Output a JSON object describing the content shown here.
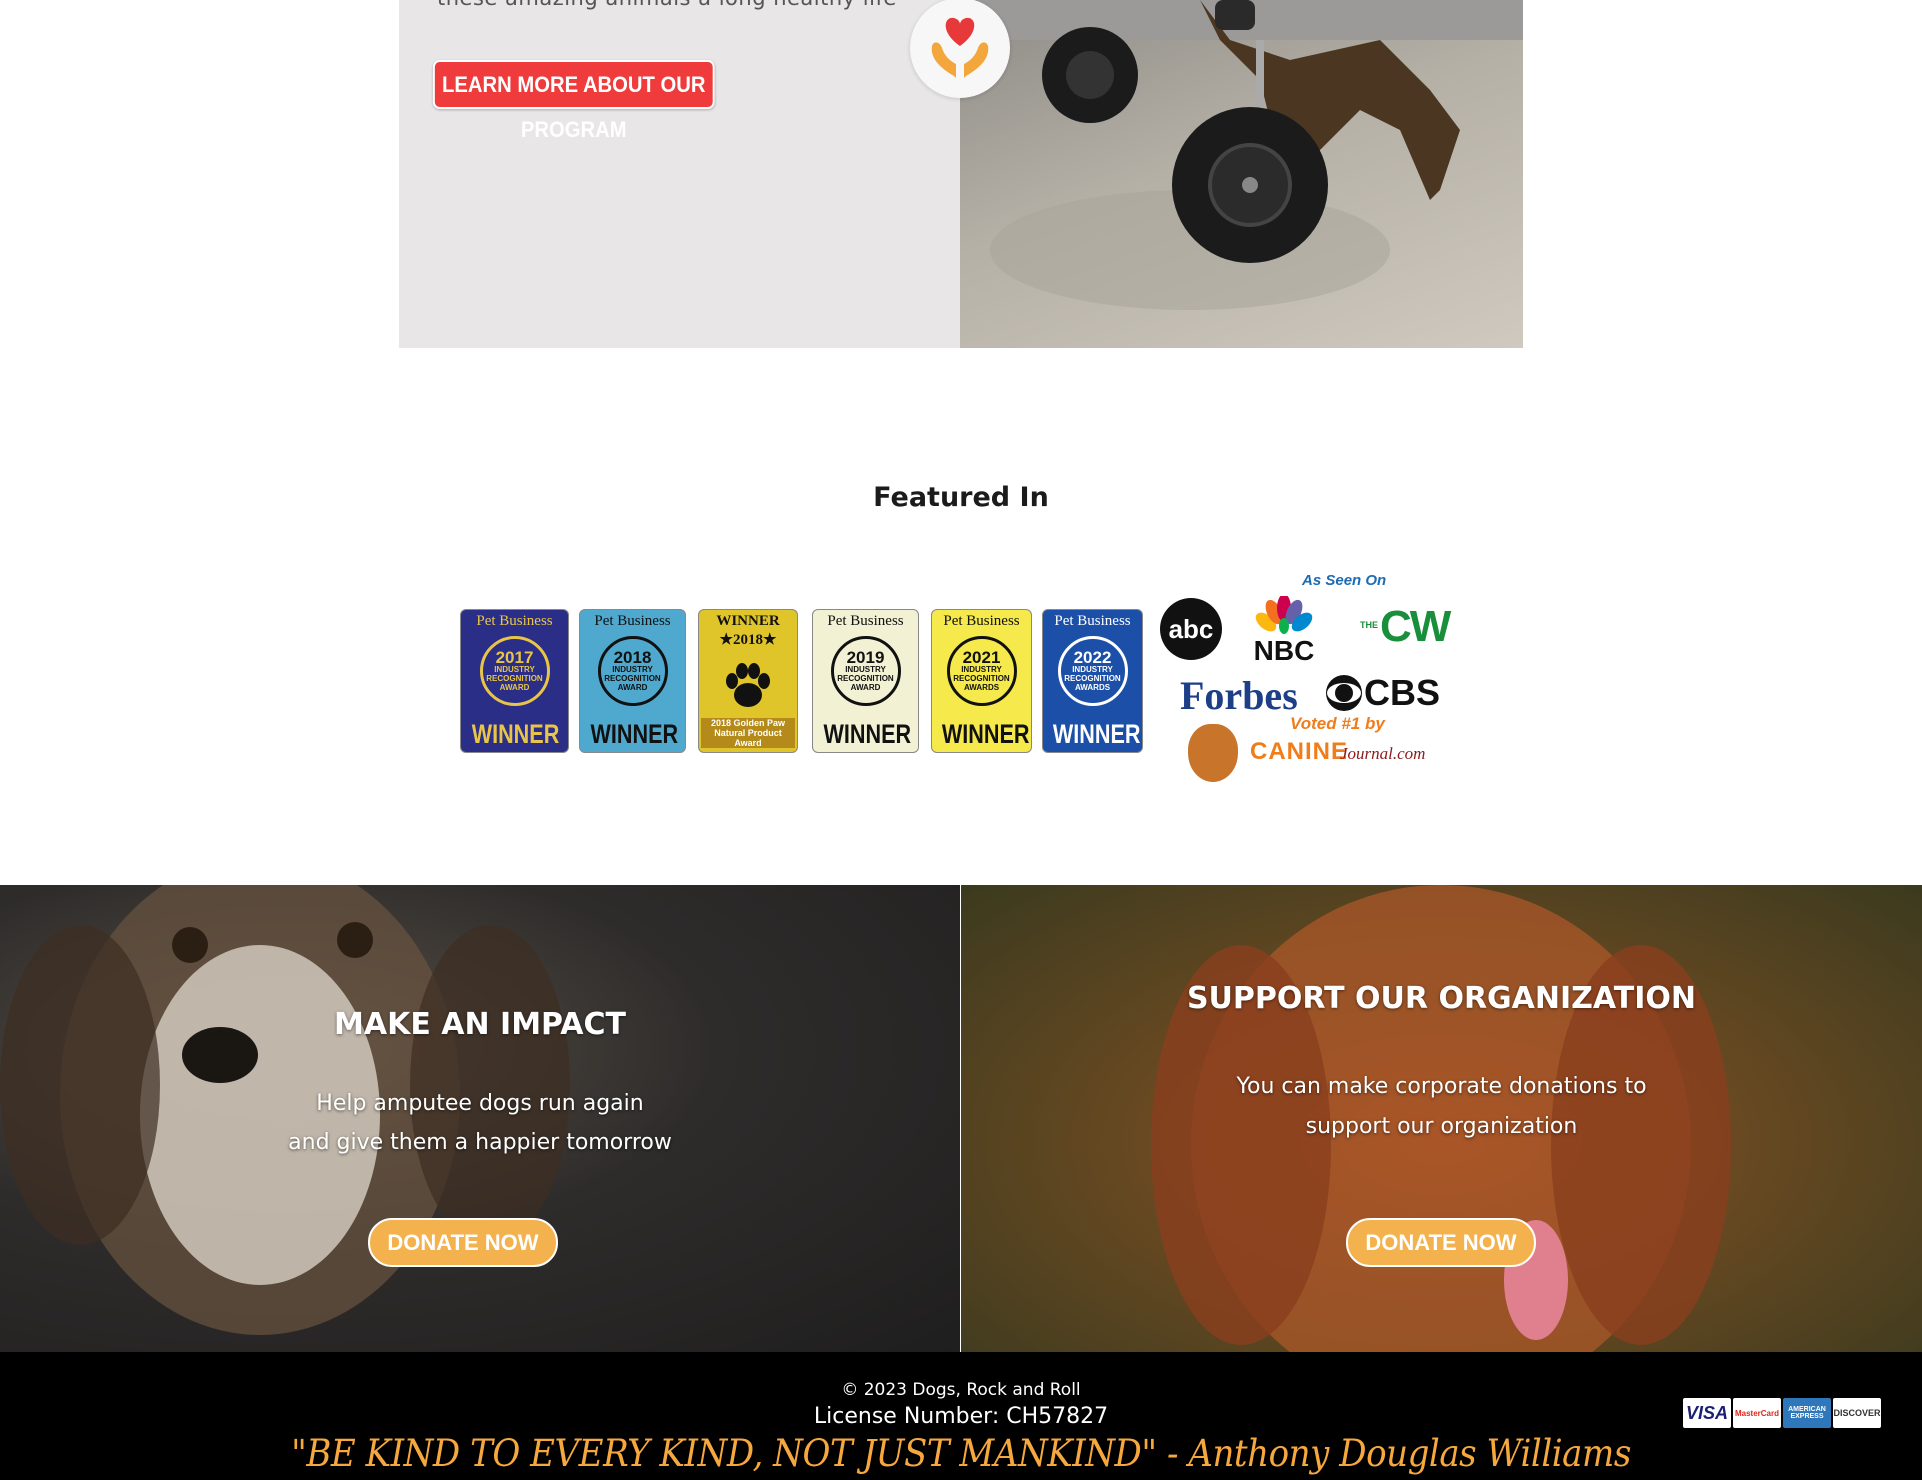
{
  "program": {
    "tagline": "these amazing animals a long healthy life",
    "learn_more_label": "LEARN MORE ABOUT OUR PROGRAM"
  },
  "featured": {
    "title": "Featured In",
    "badges": [
      {
        "brand": "Pet Business",
        "year": "2017",
        "sub": "INDUSTRY RECOGNITION AWARD",
        "win": "WINNER",
        "bg": "#2a2e86",
        "fg": "#e8c548"
      },
      {
        "brand": "Pet Business",
        "year": "2018",
        "sub": "INDUSTRY RECOGNITION AWARD",
        "win": "WINNER",
        "bg": "#4fa9cf",
        "fg": "#111111"
      },
      {
        "brand": "WINNER ★2018★",
        "year": "",
        "sub": "2018 Golden Paw Natural Product Award",
        "win": "",
        "bg": "#e0c52a",
        "fg": "#111111"
      },
      {
        "brand": "Pet Business",
        "year": "2019",
        "sub": "INDUSTRY RECOGNITION AWARD",
        "win": "WINNER",
        "bg": "#f3f1d4",
        "fg": "#111111"
      },
      {
        "brand": "Pet Business",
        "year": "2021",
        "sub": "INDUSTRY RECOGNITION AWARDS",
        "win": "WINNER",
        "bg": "#f5e94c",
        "fg": "#111111"
      },
      {
        "brand": "Pet Business",
        "year": "2022",
        "sub": "INDUSTRY RECOGNITION AWARDS",
        "win": "WINNER",
        "bg": "#1b4fa8",
        "fg": "#ffffff"
      }
    ],
    "media": {
      "as_seen_on": "As Seen On",
      "abc": "abc",
      "nbc": "NBC",
      "cw": "CW",
      "cw_the": "THE",
      "forbes": "Forbes",
      "cbs": "CBS",
      "voted": "Voted #1 by",
      "canine": "CANINE",
      "journal": "Journal.com"
    }
  },
  "impact": {
    "title": "MAKE AN IMPACT",
    "line1": "Help amputee dogs run again",
    "line2": "and give them a happier tomorrow",
    "button": "DONATE NOW"
  },
  "support": {
    "title": "SUPPORT OUR ORGANIZATION",
    "line1": "You can make corporate donations to",
    "line2": "support our organization",
    "button": "DONATE NOW"
  },
  "footer": {
    "copyright": "© 2023 Dogs, Rock and Roll",
    "license": "License Number: CH57827",
    "quote": "\"BE KIND TO EVERY KIND, NOT JUST MANKIND\" - Anthony Douglas Williams",
    "cards": [
      {
        "name": "VISA",
        "bg": "#ffffff",
        "fg": "#1a1f71"
      },
      {
        "name": "MasterCard",
        "bg": "#ffffff",
        "fg": "#e0261b"
      },
      {
        "name": "AMERICAN EXPRESS",
        "bg": "#2e77bb",
        "fg": "#ffffff"
      },
      {
        "name": "DISCOVER",
        "bg": "#ffffff",
        "fg": "#333333"
      }
    ]
  }
}
